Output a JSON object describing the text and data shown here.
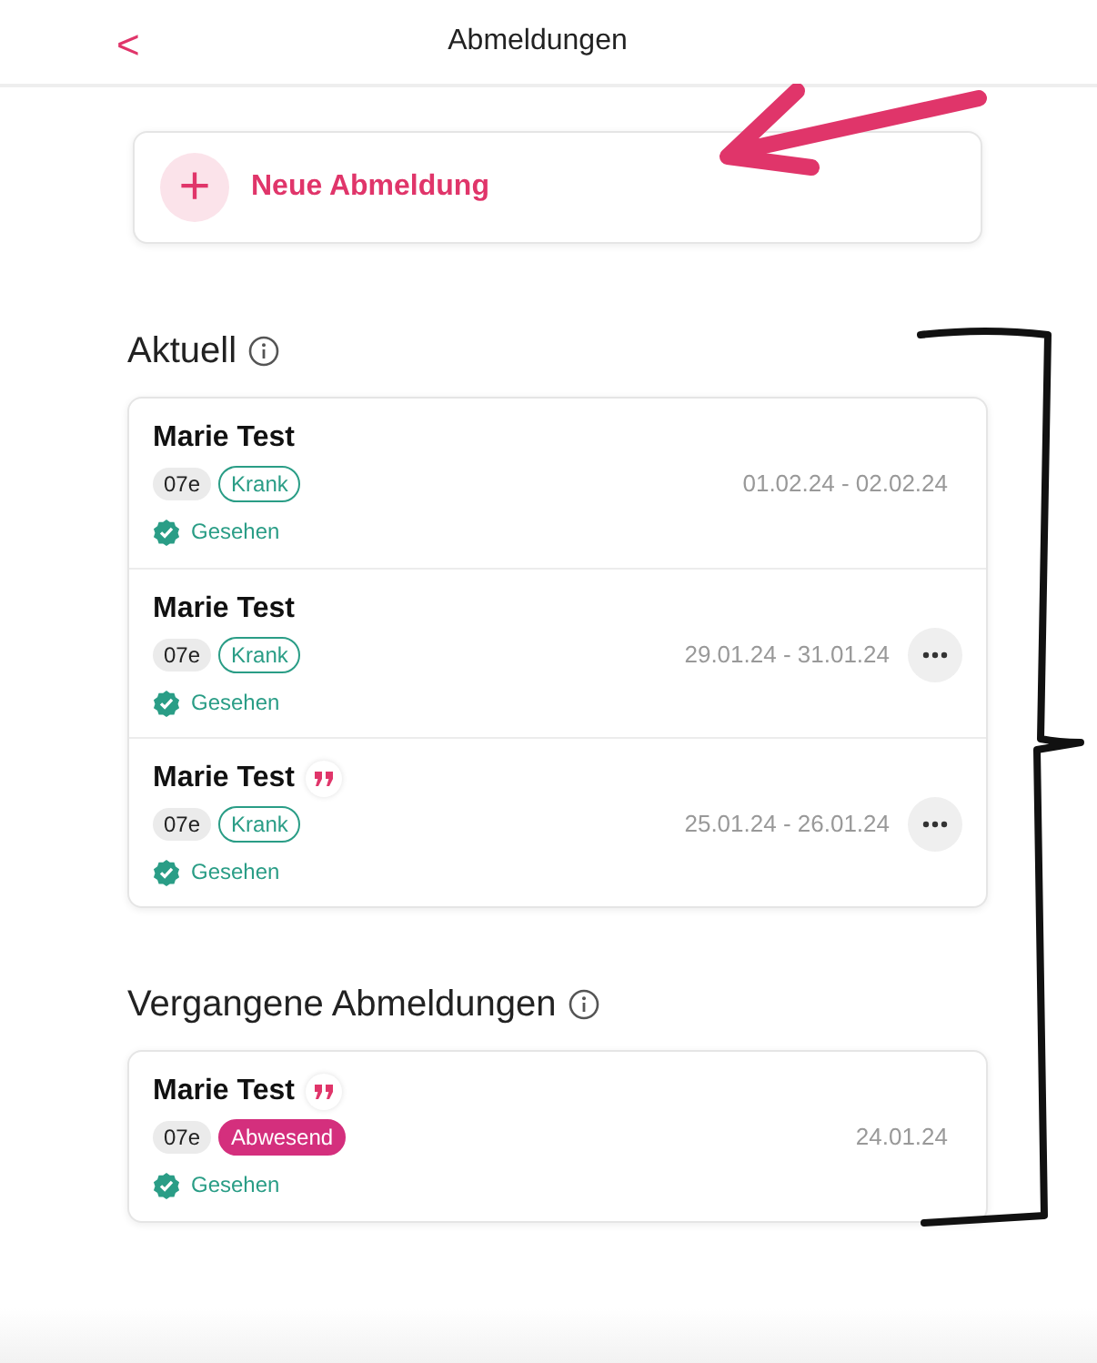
{
  "header": {
    "back": "<",
    "title": "Abmeldungen"
  },
  "new_button": {
    "icon": "+",
    "label": "Neue Abmeldung"
  },
  "sections": [
    {
      "title": "Aktuell",
      "items": [
        {
          "name": "Marie Test",
          "has_comment": false,
          "class": "07e",
          "tag": {
            "label": "Krank",
            "kind": "sick"
          },
          "date": "01.02.24 - 02.02.24",
          "has_menu": false,
          "seen": "Gesehen"
        },
        {
          "name": "Marie Test",
          "has_comment": false,
          "class": "07e",
          "tag": {
            "label": "Krank",
            "kind": "sick"
          },
          "date": "29.01.24 - 31.01.24",
          "has_menu": true,
          "seen": "Gesehen"
        },
        {
          "name": "Marie Test",
          "has_comment": true,
          "class": "07e",
          "tag": {
            "label": "Krank",
            "kind": "sick"
          },
          "date": "25.01.24 - 26.01.24",
          "has_menu": true,
          "seen": "Gesehen"
        }
      ]
    },
    {
      "title": "Vergangene Abmeldungen",
      "items": [
        {
          "name": "Marie Test",
          "has_comment": true,
          "class": "07e",
          "tag": {
            "label": "Abwesend",
            "kind": "absent"
          },
          "date": "24.01.24",
          "has_menu": false,
          "seen": "Gesehen"
        }
      ]
    }
  ]
}
